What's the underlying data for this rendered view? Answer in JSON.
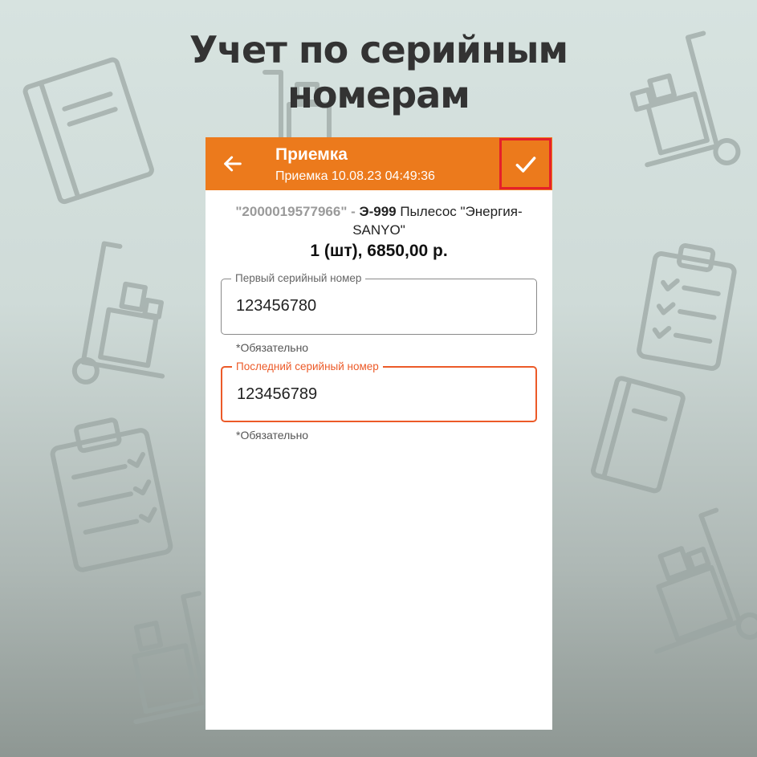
{
  "headline": {
    "line1": "Учет по серийным",
    "line2": "номерам"
  },
  "appbar": {
    "back_icon": "arrow-left-icon",
    "title": "Приемка",
    "subtitle": "Приемка 10.08.23 04:49:36",
    "confirm_icon": "checkmark-icon",
    "color": "#ec7a1c"
  },
  "product": {
    "barcode": "\"2000019577966\"",
    "separator": " - ",
    "code": "Э-999",
    "name": " Пылесос \"Энергия-SANYO\"",
    "quantity_price": "1 (шт), 6850,00 р."
  },
  "fields": [
    {
      "label": "Первый серийный номер",
      "value": "123456780",
      "hint": "*Обязательно"
    },
    {
      "label": "Последний серийный номер",
      "value": "123456789",
      "hint": "*Обязательно"
    }
  ],
  "colors": {
    "accent": "#ec7a1c",
    "active_field": "#ec5a28",
    "highlight_box": "#e5202a"
  }
}
